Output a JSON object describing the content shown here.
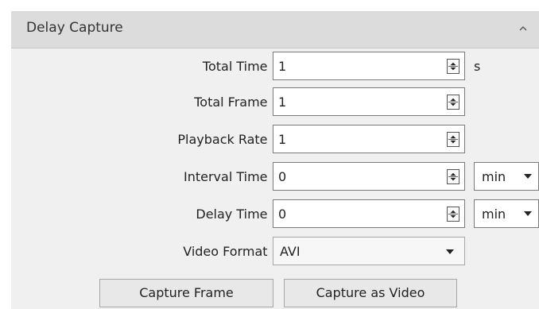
{
  "panel": {
    "title": "Delay Capture",
    "collapse_icon": "chevron-up-icon"
  },
  "fields": {
    "total_time": {
      "label": "Total Time :",
      "value": "1",
      "unit": "s"
    },
    "total_frame": {
      "label": "Total Frame :",
      "value": "1"
    },
    "playback_rate": {
      "label": "Playback Rate :",
      "value": "1"
    },
    "interval_time": {
      "label": "Interval Time :",
      "value": "0",
      "unit": "min"
    },
    "delay_time": {
      "label": "Delay Time :",
      "value": "0",
      "unit": "min"
    },
    "video_format": {
      "label": "Video Format :",
      "value": "AVI"
    }
  },
  "buttons": {
    "capture_frame": "Capture Frame",
    "capture_video": "Capture as Video"
  },
  "icons": {
    "spin": "spinner-arrows-icon",
    "dropdown": "dropdown-arrow-icon"
  }
}
